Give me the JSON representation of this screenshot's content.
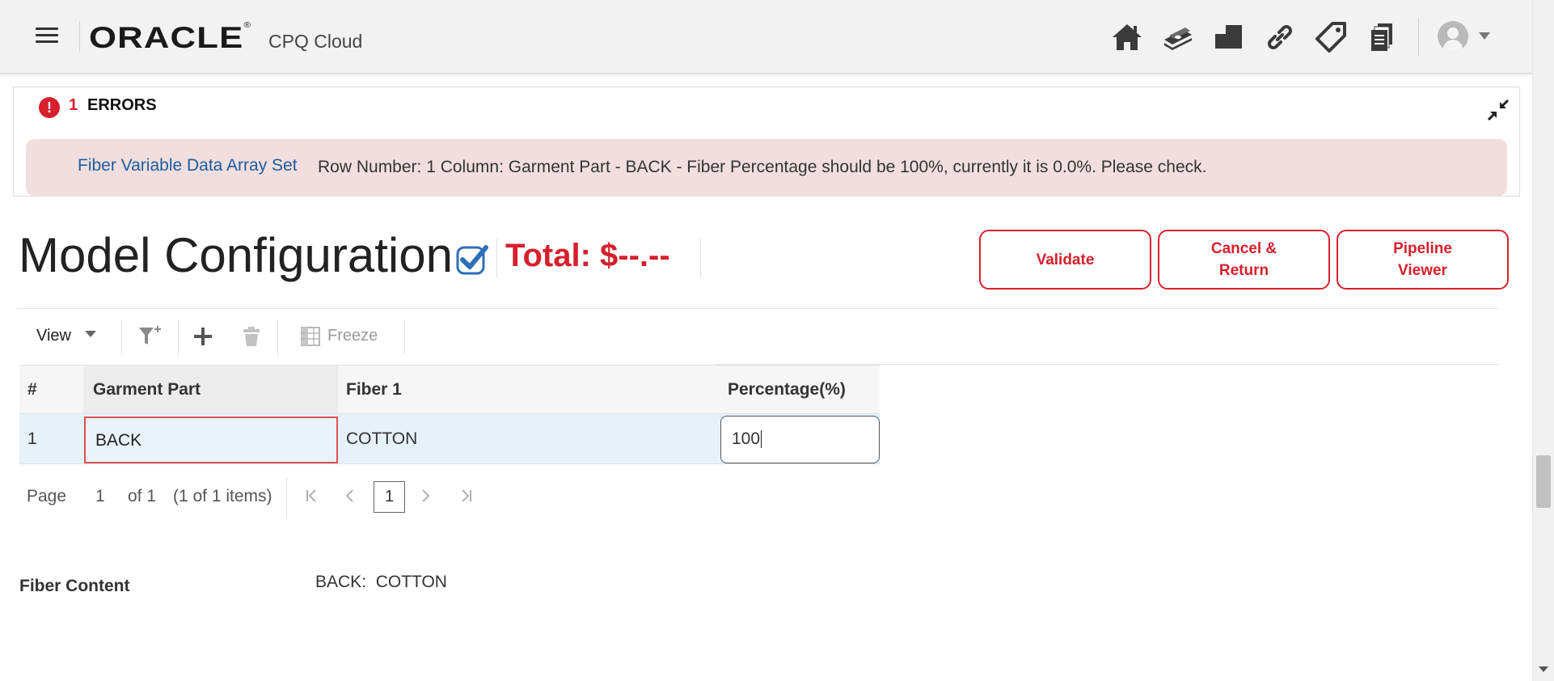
{
  "header": {
    "logo": "ORACLE",
    "logo_mark": "®",
    "product": "CPQ Cloud",
    "icons": [
      "home-icon",
      "money-icon",
      "products-icon",
      "link-icon",
      "tag-icon",
      "documents-icon"
    ]
  },
  "errors": {
    "count": "1",
    "title": "ERRORS",
    "message_link": "Fiber Variable Data Array Set",
    "message_text": "Row Number: 1 Column: Garment Part - BACK - Fiber Percentage should be 100%, currently it is 0.0%. Please check."
  },
  "page": {
    "title": "Model Configuration",
    "total": "Total: $--.--"
  },
  "actions": {
    "validate": "Validate",
    "cancel_return": "Cancel & Return",
    "pipeline_viewer": "Pipeline Viewer"
  },
  "toolbar": {
    "view": "View",
    "freeze": "Freeze"
  },
  "table": {
    "columns": [
      "#",
      "Garment Part",
      "Fiber 1",
      "Percentage(%)"
    ],
    "rows": [
      {
        "num": "1",
        "garment_part": "BACK",
        "fiber1": "COTTON",
        "percentage": "100"
      }
    ]
  },
  "pager": {
    "page_label": "Page",
    "page_num": "1",
    "of_total": "of 1",
    "items": "(1 of 1 items)",
    "current": "1"
  },
  "fiber_content": {
    "label": "Fiber Content",
    "value": "BACK:  COTTON"
  },
  "colors": {
    "accent_red": "#d6202d",
    "link_blue": "#1d5c9e",
    "error_bg": "#f2dede",
    "row_highlight": "#e6f1fa"
  }
}
